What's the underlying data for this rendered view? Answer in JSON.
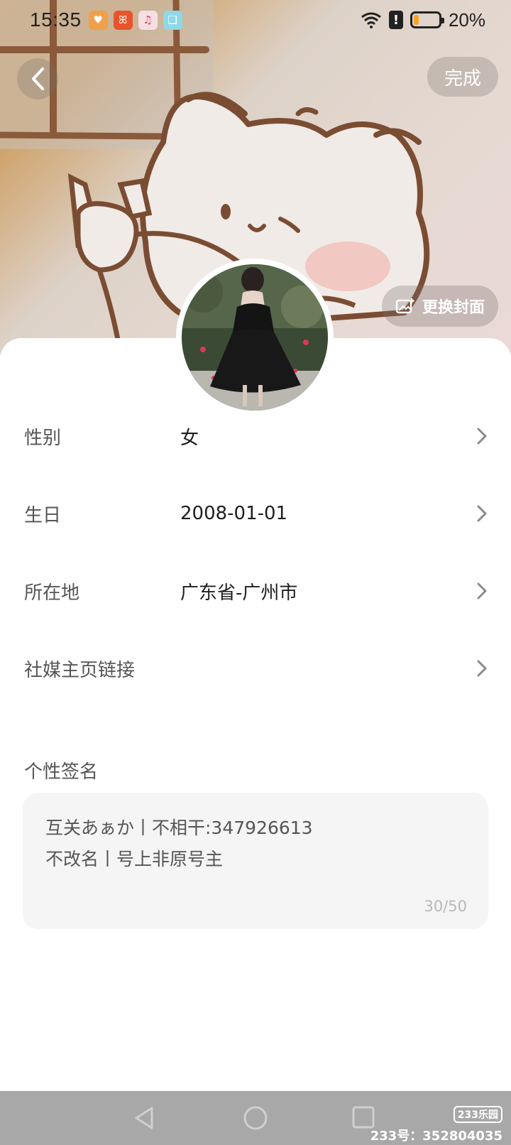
{
  "status_bar": {
    "time": "15:35",
    "battery_percent": "20%",
    "battery_level": 0.2,
    "apps": [
      {
        "name": "heart-app-icon",
        "color": "#f0a04b",
        "glyph": "♥"
      },
      {
        "name": "kuaishou-app-icon",
        "color": "#e8542c",
        "glyph": "ꕤ"
      },
      {
        "name": "music-app-icon",
        "color": "#f5dfe3",
        "glyph": "♫"
      },
      {
        "name": "reader-app-icon",
        "color": "#8fd8e8",
        "glyph": "❑"
      }
    ]
  },
  "header": {
    "done_label": "完成",
    "change_cover_label": "更换封面"
  },
  "profile": {
    "rows": [
      {
        "label": "性别",
        "value": "女"
      },
      {
        "label": "生日",
        "value": "2008-01-01"
      },
      {
        "label": "所在地",
        "value": "广东省-广州市"
      },
      {
        "label": "社媒主页链接",
        "value": ""
      }
    ],
    "signature": {
      "label": "个性签名",
      "line1": "互关あぁか丨不相干:347926613",
      "line2": "不改名丨号上非原号主",
      "count": "30/50"
    }
  },
  "watermark": {
    "logo": "233乐园",
    "text": "233号：352804035"
  },
  "colors": {
    "accent_battery": "#f3a623",
    "sheet_bg": "#ffffff",
    "signature_bg": "#f5f5f6",
    "nav_bar": "#a8a8a8"
  }
}
